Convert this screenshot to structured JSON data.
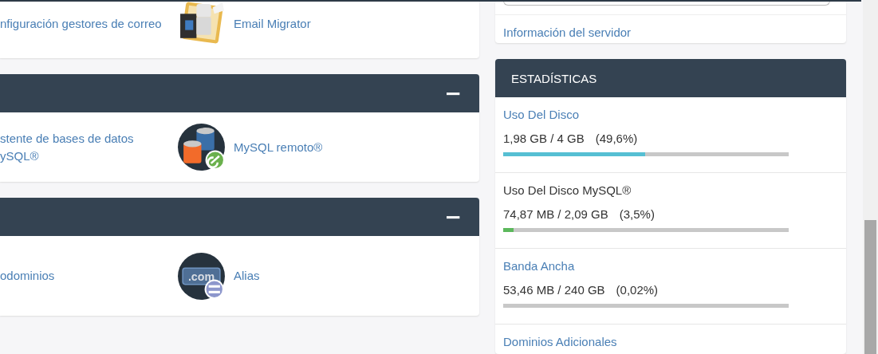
{
  "panels": [
    {
      "items": [
        {
          "label": "nfiguración gestores de correo"
        },
        {
          "kind": "migrator",
          "label": "Email Migrator"
        }
      ]
    },
    {
      "collapse_sign": "−",
      "items": [
        {
          "label": "stente de bases de datos\nySQL®"
        },
        {
          "kind": "database",
          "label": "MySQL remoto®"
        }
      ]
    },
    {
      "collapse_sign": "−",
      "items": [
        {
          "label": "odominios"
        },
        {
          "kind": "domain",
          "icon_label": ".com",
          "label": "Alias"
        }
      ]
    }
  ],
  "server_link": "Información del servidor",
  "stats": {
    "title": "ESTADÍSTICAS",
    "rows": [
      {
        "label": "Uso Del Disco",
        "kind": "link",
        "reading": "1,98 GB / 4 GB",
        "percent": "(49,6%)",
        "level": 0.496,
        "color": "#56bfd3"
      },
      {
        "label": "Uso Del Disco MySQL®",
        "kind": "plain",
        "reading": "74,87 MB / 2,09 GB",
        "percent": "(3,5%)",
        "level": 0.035,
        "color": "#5cb85c"
      },
      {
        "label": "Banda Ancha",
        "kind": "link",
        "reading": "53,46 MB / 240 GB",
        "percent": "(0,02%)",
        "level": 0.0002
      },
      {
        "label": "Dominios Adicionales",
        "kind": "link"
      }
    ]
  }
}
